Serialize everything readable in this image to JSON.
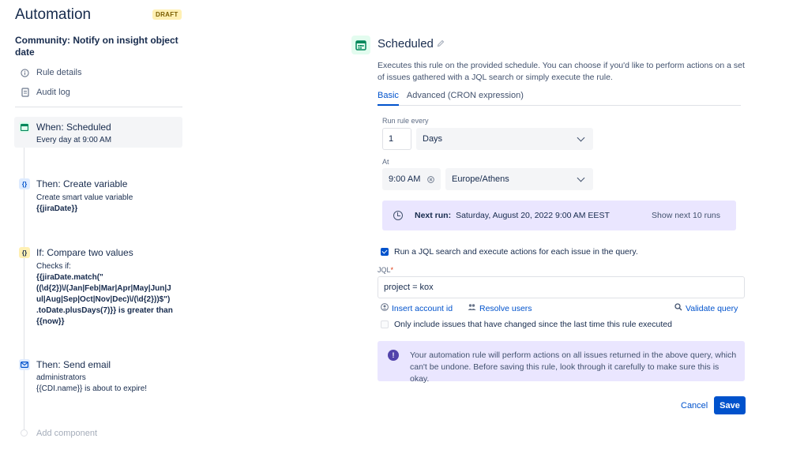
{
  "header": {
    "title": "Automation",
    "badge": "DRAFT"
  },
  "rule": {
    "name": "Community: Notify on insight object date"
  },
  "sidebar": {
    "links": [
      {
        "label": "Rule details",
        "icon": "info-icon"
      },
      {
        "label": "Audit log",
        "icon": "document-icon"
      }
    ],
    "components": [
      {
        "title": "When: Scheduled",
        "icon": "calendar-icon",
        "lines": [
          "Every day at 9:00 AM"
        ]
      },
      {
        "title": "Then: Create variable",
        "icon": "braces-icon",
        "lines": [
          "Create smart value variable",
          "{{jiraDate}}"
        ]
      },
      {
        "title": "If: Compare two values",
        "icon": "braces-icon",
        "lines": [
          "Checks if:",
          "{{jiraDate.match(\"",
          "((\\d{2})\\/(Jan|Feb|Mar|Apr|May|Jun|J",
          "ul|Aug|Sep|Oct|Nov|Dec)\\/(\\d{2}))$\")",
          ".toDate.plusDays(7)}} is greater than",
          "{{now}}"
        ]
      },
      {
        "title": "Then: Send email",
        "icon": "mail-icon",
        "lines": [
          "administrators",
          "{{CDI.name}} is about to expire!"
        ]
      }
    ],
    "add_component": "Add component"
  },
  "panel": {
    "title": "Scheduled",
    "description": "Executes this rule on the provided schedule. You can choose if you'd like to perform actions on a set of issues gathered with a JQL search or simply execute the rule.",
    "tabs": [
      {
        "label": "Basic"
      },
      {
        "label": "Advanced (CRON expression)"
      }
    ],
    "run_every": {
      "label": "Run rule every",
      "value": "1",
      "unit": "Days"
    },
    "at": {
      "label": "At",
      "time": "9:00 AM",
      "timezone": "Europe/Athens"
    },
    "next_run": {
      "label": "Next run:",
      "value": "Saturday, August 20, 2022 9:00 AM EEST",
      "link": "Show next 10 runs"
    },
    "jql_checkbox": {
      "label": "Run a JQL search and execute actions for each issue in the query.",
      "checked": true
    },
    "jql": {
      "label": "JQL",
      "required_mark": "*",
      "value": "project = kox"
    },
    "links": {
      "insert_account": "Insert account id",
      "resolve_users": "Resolve users",
      "validate": "Validate query"
    },
    "only_changed": {
      "label": "Only include issues that have changed since the last time this rule executed",
      "checked": false
    },
    "warning": "Your automation rule will perform actions on all issues returned in the above query, which can't be undone. Before saving this rule, look through it carefully to make sure this is okay.",
    "cancel": "Cancel",
    "save": "Save"
  },
  "colors": {
    "accent": "#0052cc",
    "info_bg": "#eae6ff",
    "draft_bg": "#fff0b3",
    "schedule_icon": "#00875a"
  }
}
